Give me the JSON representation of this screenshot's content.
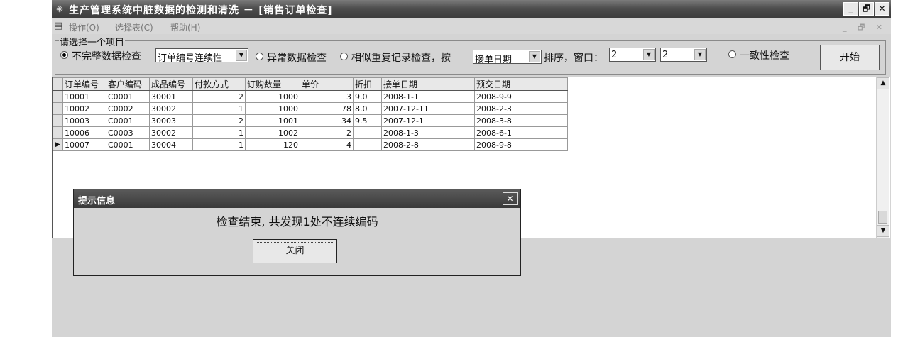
{
  "window": {
    "title": "生产管理系统中脏数据的检测和清洗 － [销售订单检查]"
  },
  "title_controls": {
    "minimize": "_",
    "restore": "🗗",
    "close": "✕"
  },
  "menubar": {
    "items": [
      {
        "label": "操作(O)"
      },
      {
        "label": "选择表(C)"
      },
      {
        "label": "帮助(H)"
      }
    ],
    "mdi_controls": "_ 🗗 ✕"
  },
  "options": {
    "group_label": "请选择一个项目",
    "incomplete_label": "不完整数据检查",
    "incomplete_combo": "订单编号连续性",
    "abnormal_label": "异常数据检查",
    "similar_label": "相似重复记录检查，按",
    "sort_combo": "接单日期",
    "sort_suffix": "排序，窗口：",
    "window_combo1": "2",
    "window_combo2": "2",
    "consistency_label": "一致性检查",
    "start_button": "开始",
    "selected": "incomplete"
  },
  "grid": {
    "columns": [
      "订单编号",
      "客户编码",
      "成品编号",
      "付款方式",
      "订购数量",
      "单价",
      "折扣",
      "接单日期",
      "预交日期"
    ],
    "rows": [
      [
        "10001",
        "C0001",
        "30001",
        "2",
        "1000",
        "3",
        "9.0",
        "2008-1-1",
        "2008-9-9"
      ],
      [
        "10002",
        "C0002",
        "30002",
        "1",
        "1000",
        "78",
        "8.0",
        "2007-12-11",
        "2008-2-3"
      ],
      [
        "10003",
        "C0001",
        "30003",
        "2",
        "1001",
        "34",
        "9.5",
        "2007-12-1",
        "2008-3-8"
      ],
      [
        "10006",
        "C0003",
        "30002",
        "1",
        "1002",
        "2",
        "",
        "2008-1-3",
        "2008-6-1"
      ],
      [
        "10007",
        "C0001",
        "30004",
        "1",
        "120",
        "4",
        "",
        "2008-2-8",
        "2008-9-8"
      ]
    ],
    "current_row_marker": "▶",
    "current_row": 4
  },
  "dialog": {
    "title": "提示信息",
    "message": "检查结束, 共发现1处不连续编码",
    "close_button": "关闭",
    "close_icon": "✕"
  },
  "scrollbar": {
    "up": "▲",
    "down": "▼"
  }
}
